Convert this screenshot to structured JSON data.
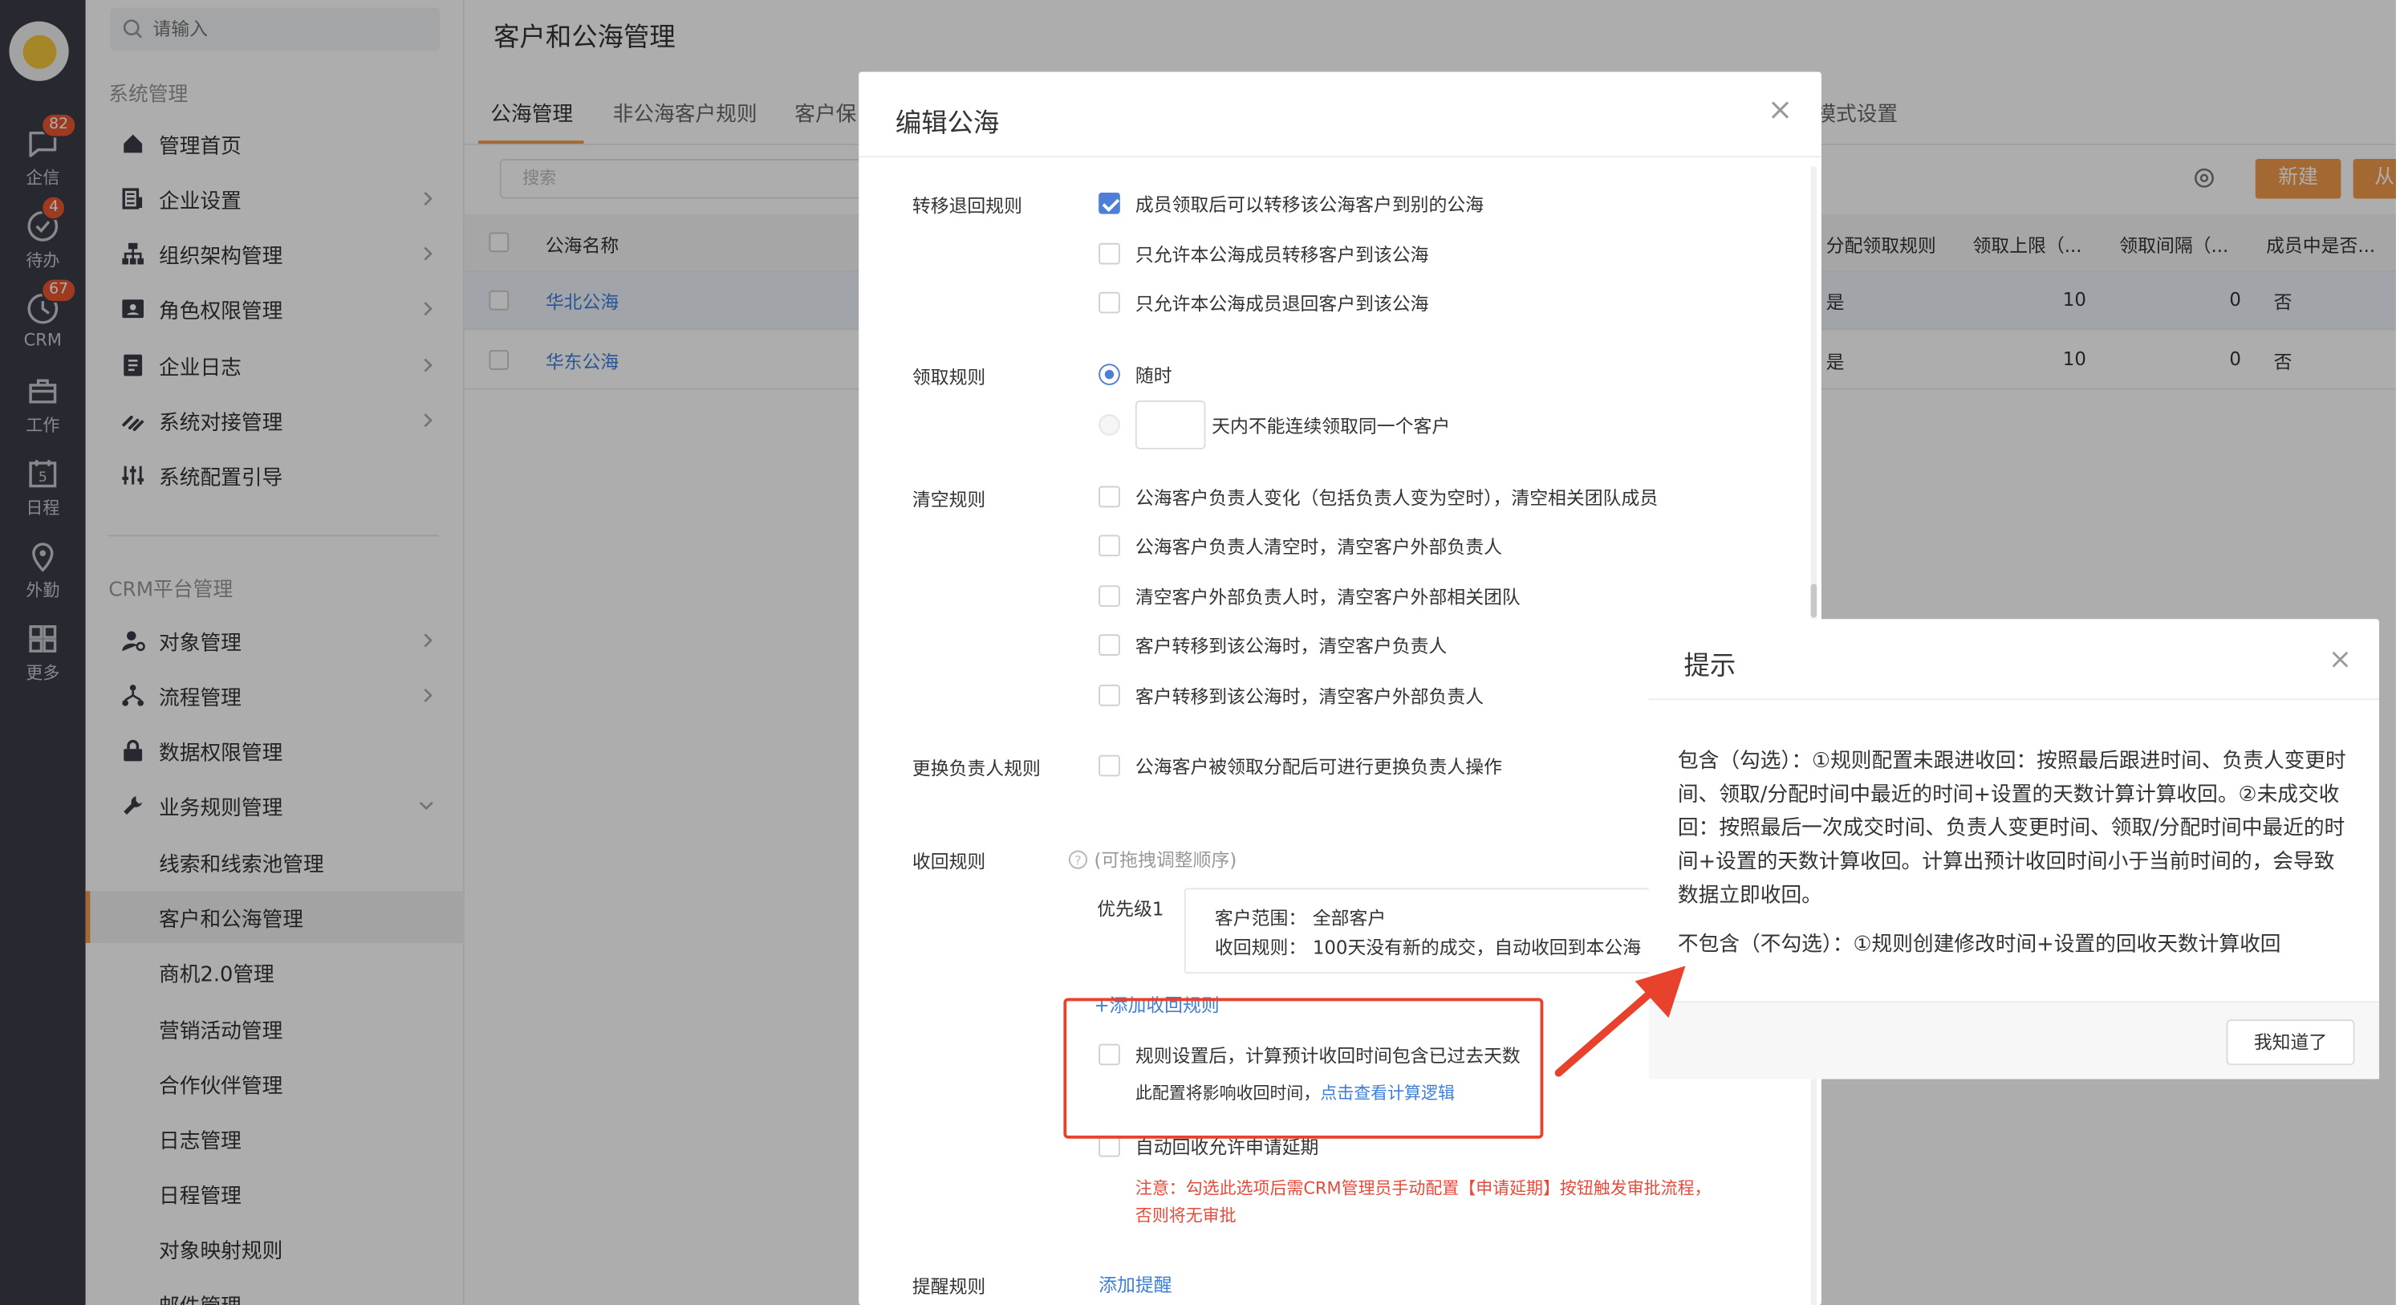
{
  "rail": {
    "items": [
      {
        "label": "企信",
        "icon": "chat-icon",
        "badge": "82"
      },
      {
        "label": "待办",
        "icon": "check-circle-icon",
        "badge": "4"
      },
      {
        "label": "CRM",
        "icon": "clock-icon",
        "badge": "67"
      },
      {
        "label": "工作",
        "icon": "briefcase-icon",
        "badge": ""
      },
      {
        "label": "日程",
        "icon": "calendar-icon",
        "badge": ""
      },
      {
        "label": "外勤",
        "icon": "location-icon",
        "badge": ""
      },
      {
        "label": "更多",
        "icon": "grid-icon",
        "badge": ""
      }
    ],
    "calendar_day": "5"
  },
  "nav": {
    "search_placeholder": "请输入",
    "group_system": "系统管理",
    "system_items": [
      "管理首页",
      "企业设置",
      "组织架构管理",
      "角色权限管理",
      "企业日志",
      "系统对接管理",
      "系统配置引导"
    ],
    "group_crm": "CRM平台管理",
    "crm_items": [
      "对象管理",
      "流程管理",
      "数据权限管理",
      "业务规则管理"
    ],
    "sub_items": [
      "线索和线索池管理",
      "客户和公海管理",
      "商机2.0管理",
      "营销活动管理",
      "合作伙伴管理",
      "日志管理",
      "日程管理",
      "对象映射规则",
      "邮件管理"
    ]
  },
  "main": {
    "title": "客户和公海管理",
    "tabs": [
      "公海管理",
      "非公海客户规则",
      "客户保",
      "模式设置"
    ],
    "search_placeholder": "搜索",
    "btn_new": "新建",
    "btn_from": "从",
    "table": {
      "col_name": "公海名称",
      "cols_right": [
        "分配领取规则",
        "领取上限（...",
        "领取间隔（...",
        "成员中是否..."
      ],
      "rows": [
        {
          "name": "华北公海",
          "rule": "是",
          "limit": "10",
          "interval": "0",
          "member": "否"
        },
        {
          "name": "华东公海",
          "rule": "是",
          "limit": "10",
          "interval": "0",
          "member": "否"
        }
      ]
    }
  },
  "dialog": {
    "title": "编辑公海",
    "transfer": {
      "label": "转移退回规则",
      "options": [
        "成员领取后可以转移该公海客户到别的公海",
        "只允许本公海成员转移客户到该公海",
        "只允许本公海成员退回客户到该公海"
      ]
    },
    "claim": {
      "label": "领取规则",
      "anytime": "随时",
      "days_text": "天内不能连续领取同一个客户"
    },
    "clear": {
      "label": "清空规则",
      "options": [
        "公海客户负责人变化（包括负责人变为空时），清空相关团队成员",
        "公海客户负责人清空时，清空客户外部负责人",
        "清空客户外部负责人时，清空客户外部相关团队",
        "客户转移到该公海时，清空客户负责人",
        "客户转移到该公海时，清空客户外部负责人"
      ]
    },
    "change_owner": {
      "label": "更换负责人规则",
      "option": "公海客户被领取分配后可进行更换负责人操作"
    },
    "recycle": {
      "label": "收回规则",
      "hint": "(可拖拽调整顺序)",
      "priority": "优先级1",
      "scope_label": "客户范围：",
      "scope_value": "全部客户",
      "rule_label": "收回规则：",
      "rule_value": "100天没有新的成交，自动收回到本公海",
      "add": "+添加收回规则",
      "past_days": "规则设置后，计算预计收回时间包含已过去天数",
      "impact": "此配置将影响收回时间，",
      "view_logic": "点击查看计算逻辑",
      "auto_extend": "自动回收允许申请延期",
      "note_line1": "注意：勾选此选项后需CRM管理员手动配置【申请延期】按钮触发审批流程，",
      "note_line2": "否则将无审批"
    },
    "remind": {
      "label": "提醒规则",
      "add": "添加提醒"
    }
  },
  "tip": {
    "title": "提示",
    "para1": "包含（勾选）：①规则配置未跟进收回：按照最后跟进时间、负责人变更时间、领取/分配时间中最近的时间+设置的天数计算计算收回。②未成交收回：按照最后一次成交时间、负责人变更时间、领取/分配时间中最近的时间+设置的天数计算收回。计算出预计收回时间小于当前时间的，会导致数据立即收回。",
    "para2": "不包含（不勾选）：①规则创建修改时间+设置的回收天数计算收回",
    "ok": "我知道了"
  },
  "colors": {
    "accent": "#f29a4a",
    "link": "#3d7fd8",
    "highlight": "#e8412c",
    "checkbox": "#4f7ed8"
  }
}
